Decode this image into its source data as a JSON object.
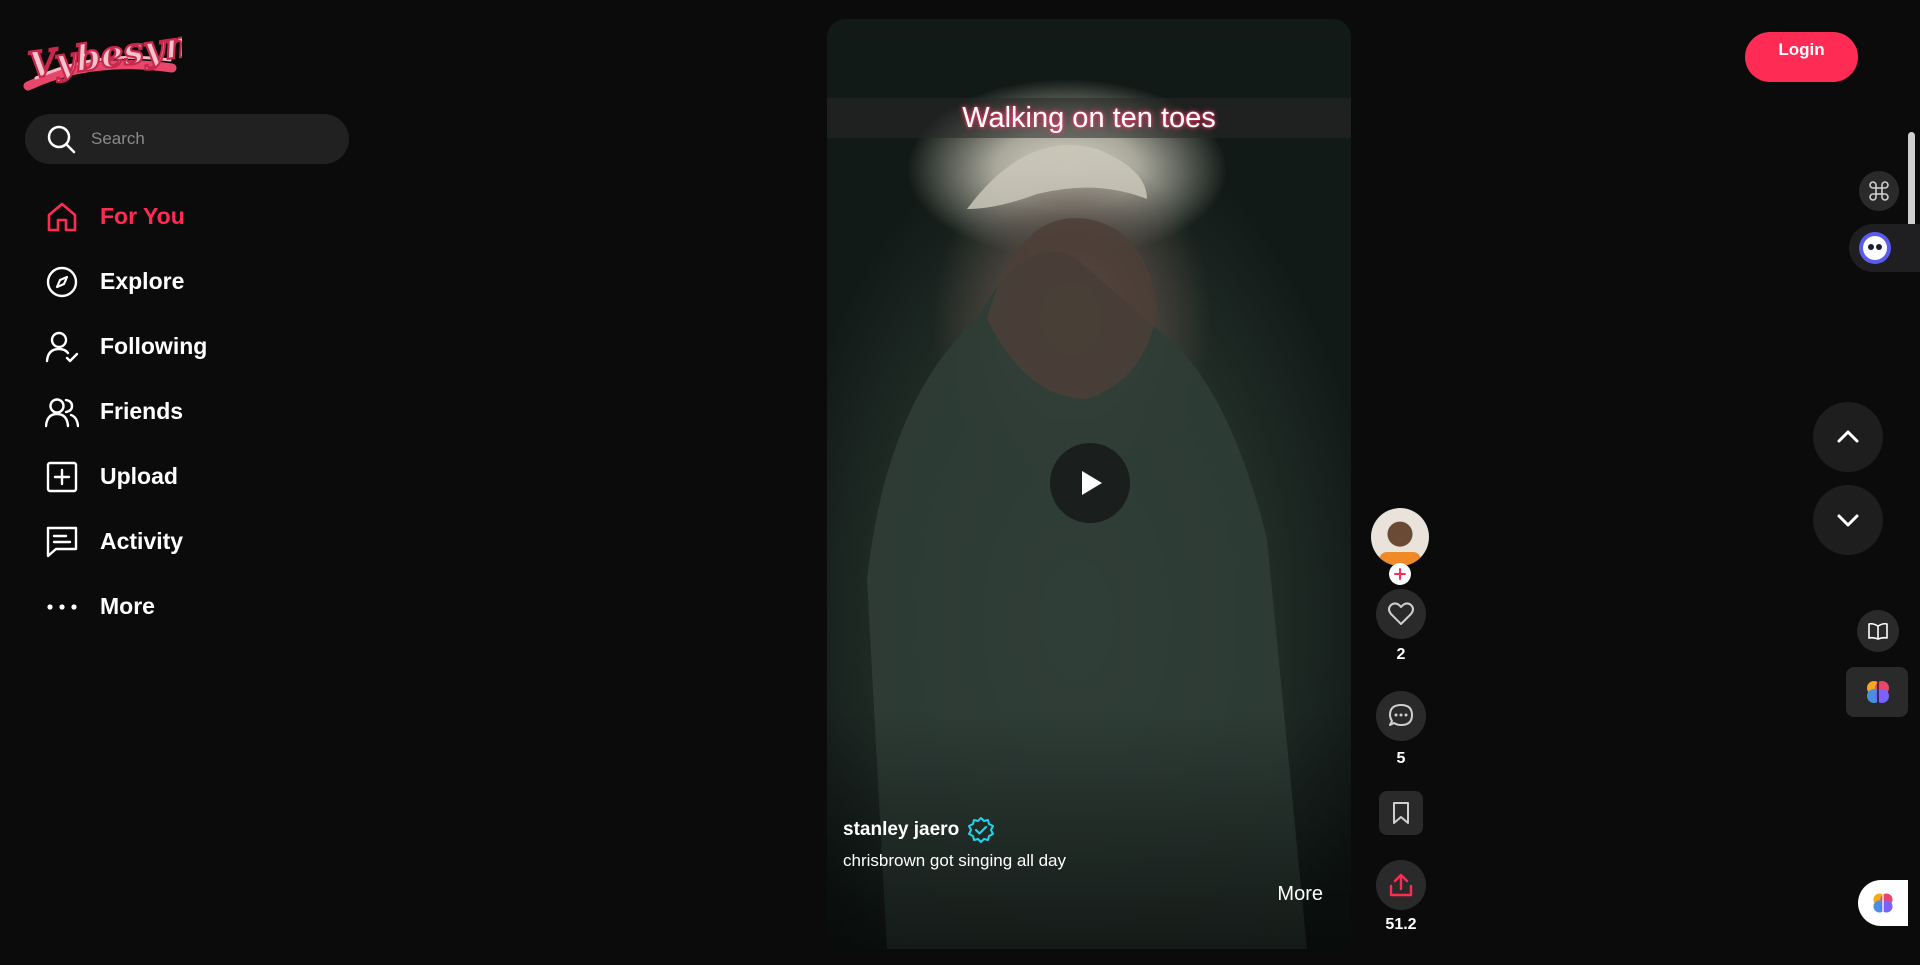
{
  "app": {
    "logo_text": "Vybesync"
  },
  "search": {
    "placeholder": "Search"
  },
  "nav": {
    "items": [
      {
        "label": "For You",
        "icon": "home-icon",
        "active": true
      },
      {
        "label": "Explore",
        "icon": "compass-icon"
      },
      {
        "label": "Following",
        "icon": "user-check-icon"
      },
      {
        "label": "Friends",
        "icon": "users-icon"
      },
      {
        "label": "Upload",
        "icon": "plus-square-icon"
      },
      {
        "label": "Activity",
        "icon": "message-square-icon"
      },
      {
        "label": "More",
        "icon": "more-dots-icon"
      }
    ]
  },
  "video": {
    "caption": "Walking on ten toes",
    "author": "stanley jaero",
    "verified": true,
    "description": "chrisbrown got singing all day",
    "more_label": "More"
  },
  "actions": {
    "likes": "2",
    "comments": "5",
    "shares": "51.2"
  },
  "header": {
    "login_label": "Login"
  },
  "colors": {
    "accent": "#fe2c55",
    "verified": "#20d5ec",
    "background": "#0b0b0b"
  }
}
